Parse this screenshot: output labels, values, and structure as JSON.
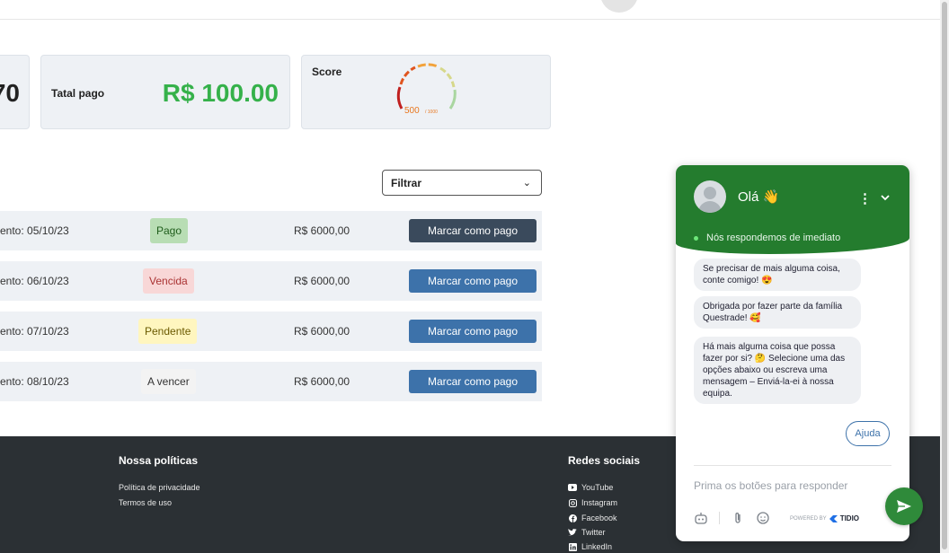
{
  "summary": {
    "partial_value": "70",
    "paid_label": "Tatal pago",
    "paid_value": "R$ 100.00",
    "score_label": "Score",
    "score_value": "500",
    "score_max": "/ 1000"
  },
  "filter": {
    "label": "Filtrar"
  },
  "rows": [
    {
      "due": "ento: 05/10/23",
      "status": "Pago",
      "amount": "R$ 6000,00",
      "action": "Marcar como pago"
    },
    {
      "due": "ento: 06/10/23",
      "status": "Vencida",
      "amount": "R$ 6000,00",
      "action": "Marcar como pago"
    },
    {
      "due": "ento: 07/10/23",
      "status": "Pendente",
      "amount": "R$ 6000,00",
      "action": "Marcar como pago"
    },
    {
      "due": "ento: 08/10/23",
      "status": "A vencer",
      "amount": "R$ 6000,00",
      "action": "Marcar como pago"
    }
  ],
  "footer": {
    "policies_title": "Nossa políticas",
    "privacy": "Política de privacidade",
    "terms": "Termos de uso",
    "social_title": "Redes sociais",
    "social": [
      "YouTube",
      "Instagram",
      "Facebook",
      "Twitter",
      "LinkedIn"
    ]
  },
  "chat": {
    "title": "Olá 👋",
    "status": "Nós respondemos de imediato",
    "messages": [
      "Se precisar de mais alguma coisa, conte comigo! 😍",
      "Obrigada por fazer parte da família Questrade! 🥰",
      "Há mais alguma coisa que possa fazer por si? 🤔 Selecione uma das opções abaixo ou escreva uma mensagem – Enviá-la-ei à nossa equipa."
    ],
    "quick_reply": "Ajuda",
    "input_placeholder": "Prima os botões para responder",
    "powered_by": "POWERED BY",
    "brand": "TIDIO"
  },
  "colors": {
    "accent_green": "#35b14a",
    "chat_green": "#247c2e",
    "button_blue": "#3d72aa",
    "button_dark": "#3a4a5c",
    "footer_bg": "#2b3034"
  },
  "icons": [
    "youtube-icon",
    "instagram-icon",
    "facebook-icon",
    "twitter-icon",
    "linkedin-icon",
    "send-icon",
    "emoji-icon",
    "attachment-icon",
    "bot-icon",
    "more-icon",
    "chevron-down-icon"
  ]
}
